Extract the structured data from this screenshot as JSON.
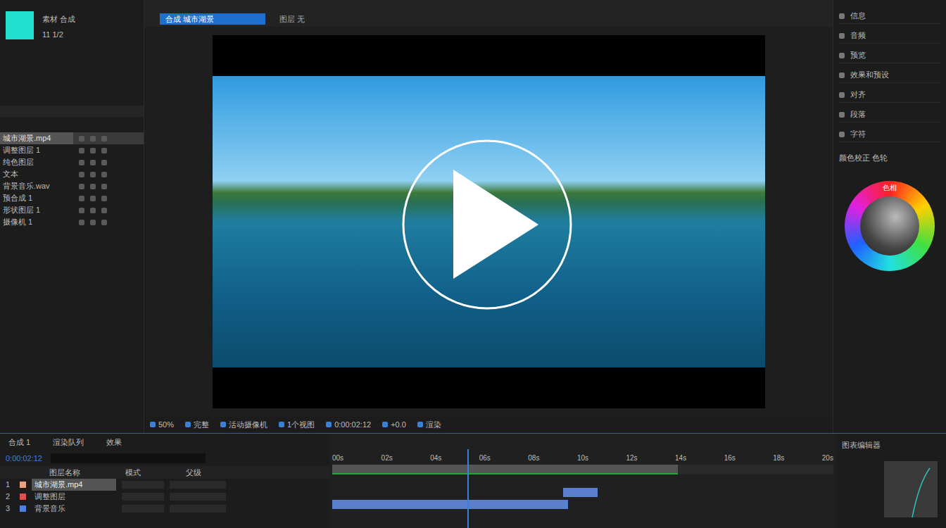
{
  "project": {
    "lines": [
      "素材 合成",
      "11 1/2"
    ]
  },
  "left_list": [
    {
      "name": "城市湖景.mp4",
      "selected": true
    },
    {
      "name": "调整图层 1",
      "selected": false
    },
    {
      "name": "纯色图层",
      "selected": false
    },
    {
      "name": "文本",
      "selected": false
    },
    {
      "name": "背景音乐.wav",
      "selected": false
    },
    {
      "name": "预合成 1",
      "selected": false
    },
    {
      "name": "形状图层 1",
      "selected": false
    },
    {
      "name": "摄像机 1",
      "selected": false
    }
  ],
  "viewer": {
    "tabs": [
      {
        "label": "合成 城市湖景",
        "selected": true
      },
      {
        "label": "图层 无",
        "selected": false
      }
    ]
  },
  "toolbar": [
    "50%",
    "完整",
    "活动摄像机",
    "1个视图",
    "0:00:02:12",
    "+0.0",
    "渲染"
  ],
  "right_panel": {
    "sections": [
      "信息",
      "音频",
      "预览",
      "效果和预设",
      "对齐",
      "段落",
      "字符"
    ],
    "color_section": "颜色校正 色轮",
    "color_wheel_label": "色相"
  },
  "timeline": {
    "tabs": [
      "合成 1",
      "渲染队列",
      "效果"
    ],
    "timecode": "0:00:02:12",
    "columns": [
      "图层名称",
      "模式",
      "父级"
    ],
    "layers": [
      {
        "index": "1",
        "name": "城市湖景.mp4",
        "color": "#e8a080",
        "selected": true,
        "clip": null
      },
      {
        "index": "2",
        "name": "调整图层",
        "color": "#e05050",
        "selected": false,
        "clip": {
          "start": 0.46,
          "end": 0.53
        }
      },
      {
        "index": "3",
        "name": "背景音乐",
        "color": "#5080e0",
        "selected": false,
        "clip": {
          "start": 0.0,
          "end": 0.47
        }
      }
    ],
    "ruler": [
      "00s",
      "02s",
      "04s",
      "06s",
      "08s",
      "10s",
      "12s",
      "14s",
      "16s",
      "18s",
      "20s"
    ],
    "playhead": 0.27,
    "work_area": 0.69
  },
  "graph_panel": {
    "title": "图表编辑器"
  }
}
